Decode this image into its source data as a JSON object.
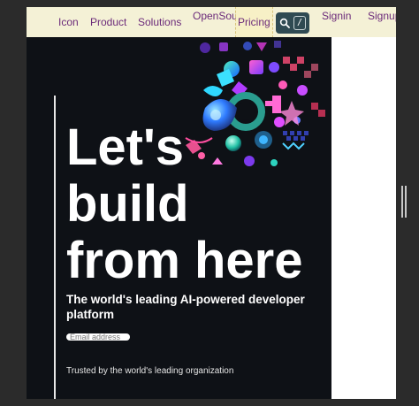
{
  "nav": {
    "icon": "Icon",
    "product": "Product",
    "solutions": "Solutions",
    "open_source_1": "Open",
    "open_source_2": "Source",
    "pricing": "Pricing",
    "search_key": "/",
    "sign_in_1": "Sign",
    "sign_in_2": "in",
    "sign_up_1": "Sign",
    "sign_up_2": "up"
  },
  "hero": {
    "headline": [
      "Let's",
      "build",
      "from here"
    ],
    "subhead": "The world's leading AI-powered developer platform",
    "email_placeholder": "Email address",
    "trusted": "Trusted by the world's leading organization"
  },
  "icons": {
    "search": "search-icon",
    "hero_art": "abstract-shapes-illustration",
    "scrollbar": "scrollbar-grip"
  },
  "colors": {
    "nav_bg": "#f4f1d6",
    "nav_link": "#6b2a7a",
    "hero_bg": "#0e1116",
    "search_bg": "#2f4a52"
  }
}
